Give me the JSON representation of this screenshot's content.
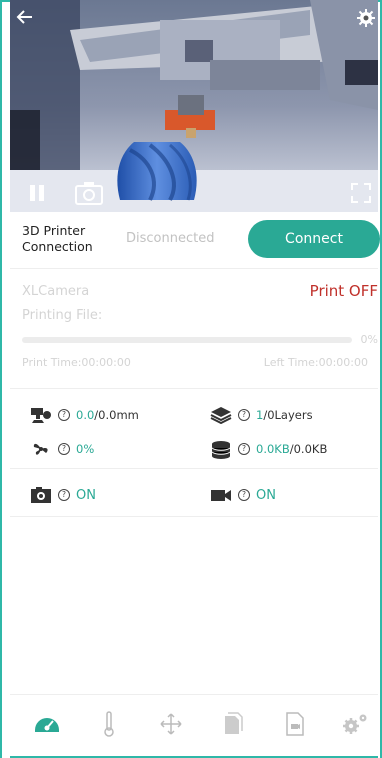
{
  "camera": {
    "back_icon": "back-arrow-icon",
    "settings_icon": "gear-icon",
    "pause_icon": "pause-icon",
    "snapshot_icon": "camera-icon",
    "fullscreen_icon": "fullscreen-icon"
  },
  "connection": {
    "label": "3D Printer Connection",
    "status": "Disconnected",
    "button": "Connect"
  },
  "print": {
    "camera_name": "XLCamera",
    "status": "Print OFF",
    "file_label": "Printing File:",
    "progress_text": "0%",
    "progress_value": 0,
    "print_time": "Print Time:00:00:00",
    "left_time": "Left Time:00:00:00"
  },
  "metrics": {
    "height_current": "0.0",
    "height_total": "/0.0mm",
    "layers_current": "1",
    "layers_total": "/0Layers",
    "fan": "0%",
    "storage_current": "0.0KB",
    "storage_total": "/0.0KB",
    "qmark": "?"
  },
  "cameras": {
    "photo_status": "ON",
    "video_status": "ON"
  },
  "colors": {
    "accent": "#2aa995",
    "status_off": "#c0312b"
  }
}
